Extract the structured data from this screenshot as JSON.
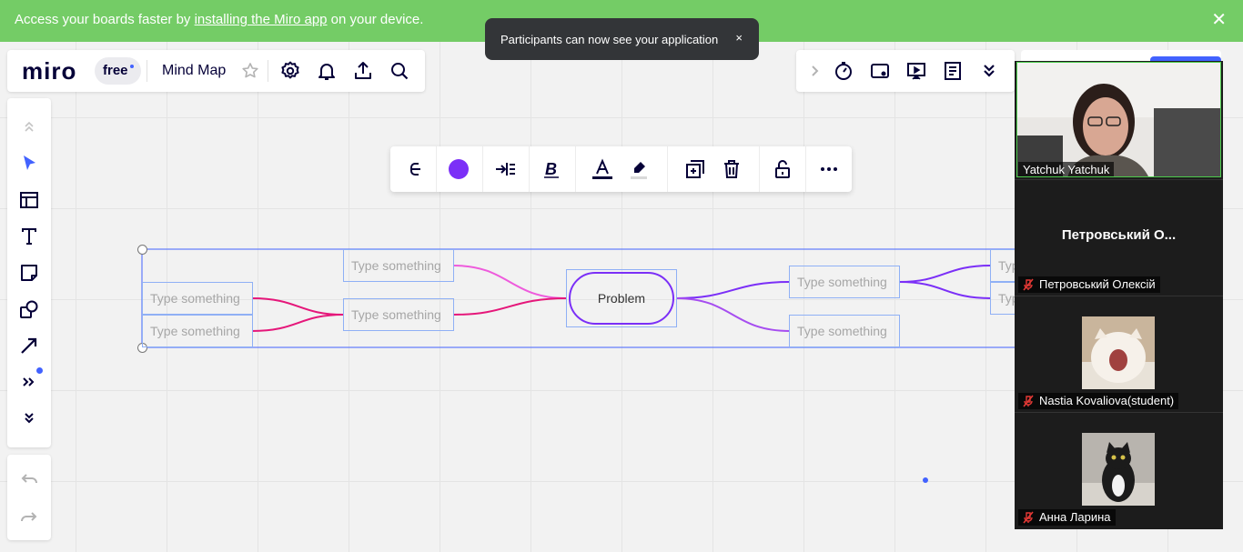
{
  "banner": {
    "text_before": "Access your boards faster by ",
    "link": "installing the Miro app",
    "text_after": " on your device.",
    "close": "✕"
  },
  "toast": {
    "text": "Participants can now see your application",
    "close": "×"
  },
  "topbar": {
    "logo": "miro",
    "plan": "free",
    "board_title": "Mind Map",
    "icons": [
      "star-icon",
      "settings-icon",
      "bell-icon",
      "share-icon",
      "search-icon"
    ]
  },
  "topright": {
    "icons": [
      "chevron-right-icon",
      "timer-icon",
      "card-icon",
      "present-icon",
      "notes-icon",
      "chevrons-down-icon"
    ]
  },
  "left_toolbar": {
    "icons": [
      "collapse-up-icon",
      "select-icon",
      "frame-icon",
      "text-icon",
      "sticky-note-icon",
      "shapes-icon",
      "arrow-icon",
      "more-tools-icon",
      "expand-down-icon"
    ],
    "undo_redo": [
      "undo-icon",
      "redo-icon"
    ]
  },
  "context_toolbar": {
    "icons": [
      "branch-icon",
      "color-icon",
      "align-icon",
      "bold-icon",
      "text-color-icon",
      "highlight-icon",
      "duplicate-icon",
      "delete-icon",
      "lock-icon",
      "more-icon"
    ],
    "colors": {
      "node_color": "#7b2ff7",
      "text_color": "#050038",
      "highlight": "#bfbfbf"
    }
  },
  "mindmap": {
    "center": "Problem",
    "placeholder": "Type something",
    "right_partial": "Typ",
    "colors": {
      "pink": "#e5177a",
      "light_pink": "#ee5bdc",
      "purple": "#7b2ff7",
      "violet": "#a64df0"
    }
  },
  "participants": [
    {
      "name": "Yatchuk Yatchuk",
      "muted": false
    },
    {
      "name": "Петровський  О...",
      "full_name": "Петровський Олексій",
      "muted": true
    },
    {
      "name": "Nastia Kovaliova(student)",
      "muted": true
    },
    {
      "name": "Анна Ларина",
      "muted": true
    }
  ],
  "colors": {
    "banner": "#74cc66",
    "brand_blue": "#4262ff",
    "canvas": "#f2f2f2"
  }
}
